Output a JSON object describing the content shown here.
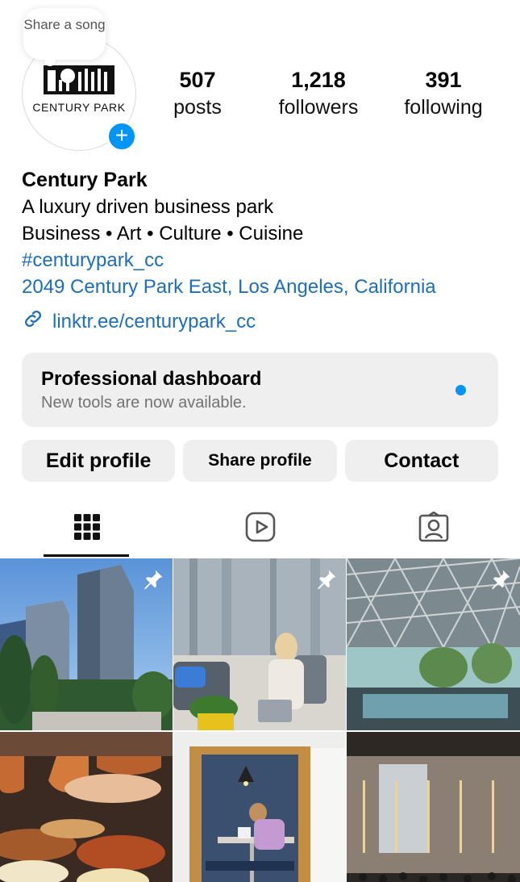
{
  "note": {
    "text": "Share a song"
  },
  "avatar": {
    "logo_text": "CENTURY PARK"
  },
  "stats": [
    {
      "num": "507",
      "label": "posts"
    },
    {
      "num": "1,218",
      "label": "followers"
    },
    {
      "num": "391",
      "label": "following"
    }
  ],
  "bio": {
    "name": "Century Park",
    "tagline": "A luxury driven business park",
    "categories": "Business • Art • Culture • Cuisine",
    "hashtag": "#centurypark_cc",
    "address": "2049 Century Park East, Los Angeles, California",
    "url": "linktr.ee/centurypark_cc"
  },
  "dashboard": {
    "title": "Professional dashboard",
    "subtitle": "New tools are now available."
  },
  "buttons": {
    "edit": "Edit profile",
    "share": "Share profile",
    "contact": "Contact"
  },
  "tabs": [
    "grid-icon",
    "reels-icon",
    "tagged-icon"
  ],
  "posts": [
    {
      "desc": "towers",
      "pinned": true
    },
    {
      "desc": "lounge",
      "pinned": true
    },
    {
      "desc": "atrium",
      "pinned": true
    },
    {
      "desc": "food",
      "pinned": false
    },
    {
      "desc": "booth",
      "pinned": false
    },
    {
      "desc": "lobby",
      "pinned": false
    }
  ],
  "colors": {
    "accent": "#0095f6",
    "link": "#1c6fb8",
    "button_bg": "#efefef"
  }
}
